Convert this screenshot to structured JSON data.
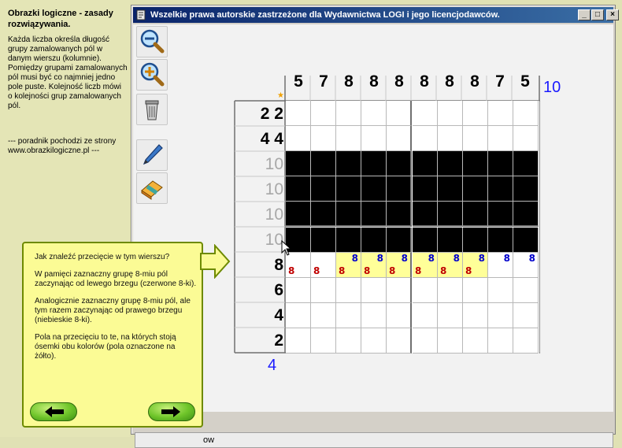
{
  "sidebar": {
    "title": "Obrazki logiczne  - zasady rozwiązywania.",
    "body": "Każda liczba określa długość grupy zamalowanych pól w danym wierszu (kolumnie). Pomiędzy grupami zamalowanych pól musi być co najmniej jedno pole puste. Kolejność liczb mówi o kolejności grup zamalowanych pól.",
    "note": "--- poradnik pochodzi ze strony www.obrazkilogiczne.pl ---"
  },
  "window": {
    "title": "Wszelkie prawa autorskie zastrzeżone dla Wydawnictwa LOGI i jego licencjodawców.",
    "min_label": "_",
    "max_label": "□",
    "close_label": "×"
  },
  "toolbar": {
    "icons": [
      "zoom-out-icon",
      "zoom-in-icon",
      "trash-icon",
      "pen-icon",
      "eraser-icon"
    ]
  },
  "puzzle": {
    "column_clues": [
      "5",
      "7",
      "8",
      "8",
      "8",
      "8",
      "8",
      "8",
      "7",
      "5"
    ],
    "column_count": "10",
    "row_clues": [
      {
        "text": "2  2",
        "solved": false
      },
      {
        "text": "4  4",
        "solved": false
      },
      {
        "text": "10",
        "solved": true
      },
      {
        "text": "10",
        "solved": true
      },
      {
        "text": "10",
        "solved": true
      },
      {
        "text": "10",
        "solved": true
      },
      {
        "text": "8",
        "solved": false
      },
      {
        "text": "6",
        "solved": false
      },
      {
        "text": "4",
        "solved": false
      },
      {
        "text": "2",
        "solved": false
      }
    ],
    "row_count": "4",
    "filled_rows": [
      2,
      3,
      4,
      5
    ],
    "active_row": 6,
    "highlight_cols": [
      2,
      3,
      4,
      5,
      6,
      7
    ],
    "red_mark_cols": [
      0,
      1,
      2,
      3,
      4,
      5,
      6,
      7
    ],
    "blue_mark_cols": [
      2,
      3,
      4,
      5,
      6,
      7,
      8,
      9
    ],
    "mark_label": "8"
  },
  "hint": {
    "p1": "Jak znaleźć przecięcie w tym wierszu?",
    "p2": "W pamięci zaznaczny grupę 8-miu pól zaczynając od lewego brzegu (czerwone 8-ki).",
    "p3": "Analogicznie zaznaczny grupę 8-miu pól, ale tym razem zaczynając od prawego brzegu (niebieskie 8-ki).",
    "p4": "Pola na przecięciu to te, na których stoją ósemki obu kolorów (pola oznaczone na żółto).",
    "prev_label": "previous-arrow",
    "next_label": "next-arrow"
  },
  "status": {
    "text": "ow"
  },
  "colors": {
    "highlight": "#ffff99",
    "red_mark": "#c00000",
    "blue_mark": "#0000cc",
    "count": "#1a1aff"
  }
}
